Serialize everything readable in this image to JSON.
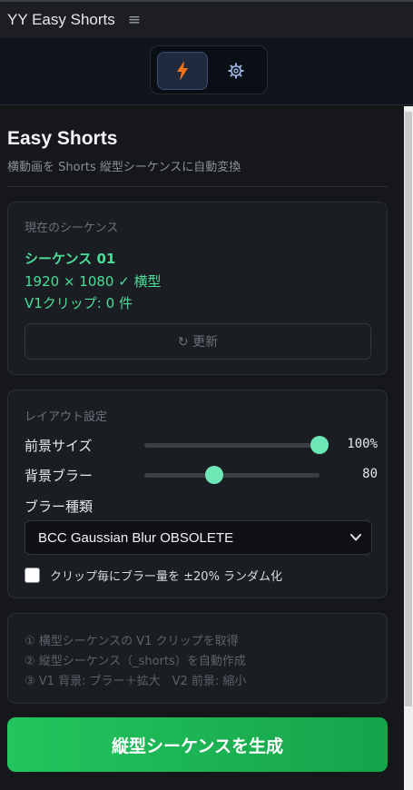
{
  "app": {
    "title": "YY Easy Shorts",
    "menu_icon": "hamburger-icon"
  },
  "toolbar": {
    "buttons": [
      {
        "icon": "lightning-icon",
        "active": true,
        "color": "#f97316"
      },
      {
        "icon": "gear-icon",
        "active": false,
        "color": "#9bb4e0"
      }
    ]
  },
  "header": {
    "title": "Easy Shorts",
    "subtitle": "横動画を Shorts 縦型シーケンスに自動変換"
  },
  "sequence_card": {
    "label": "現在のシーケンス",
    "name": "シーケンス 01",
    "resolution": "1920 × 1080  ✓ 横型",
    "clips": "V1クリップ: 0 件",
    "refresh_label": "↻ 更新"
  },
  "layout_card": {
    "label": "レイアウト設定",
    "foreground": {
      "label": "前景サイズ",
      "value": 100,
      "display": "100%"
    },
    "blur": {
      "label": "背景ブラー",
      "value": 80,
      "max": 200,
      "display": "80"
    },
    "blur_type_label": "ブラー種類",
    "blur_type_selected": "BCC Gaussian Blur OBSOLETE",
    "random_checkbox": {
      "label": "クリップ毎にブラー量を ±20% ランダム化",
      "checked": false
    }
  },
  "steps": [
    "① 横型シーケンスの V1 クリップを取得",
    "② 縦型シーケンス（_shorts）を自動作成",
    "③ V1 背景: ブラー＋拡大　V2 前景: 縮小"
  ],
  "generate_button": {
    "label": "縦型シーケンスを生成"
  },
  "colors": {
    "accent_green": "#22c55e",
    "slider_knob": "#6ee7b7",
    "text_green": "#4ade9a"
  }
}
